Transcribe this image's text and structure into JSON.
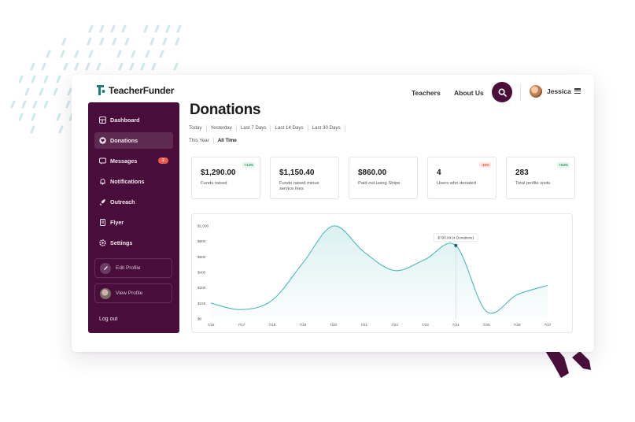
{
  "brand": {
    "name": "TeacherFunder"
  },
  "topnav": {
    "teachers": "Teachers",
    "about": "About Us"
  },
  "user": {
    "name": "Jessica"
  },
  "sidebar": {
    "items": [
      {
        "label": "Dashboard",
        "icon": "dashboard-icon"
      },
      {
        "label": "Donations",
        "icon": "heart-icon",
        "active": true
      },
      {
        "label": "Messages",
        "icon": "message-icon",
        "badge": "2"
      },
      {
        "label": "Notifications",
        "icon": "bell-icon"
      },
      {
        "label": "Outreach",
        "icon": "rocket-icon"
      },
      {
        "label": "Flyer",
        "icon": "flyer-icon"
      },
      {
        "label": "Settings",
        "icon": "gear-icon"
      }
    ],
    "edit_profile": "Edit Profile",
    "view_profile": "View Profile",
    "logout": "Log out"
  },
  "page": {
    "title": "Donations",
    "filters_row1": [
      "Today",
      "Yesterday",
      "Last 7 Days",
      "Last 14 Days",
      "Last 30 Days"
    ],
    "filters_row2": [
      "This Year",
      "All Time"
    ],
    "active_filter": "All Time"
  },
  "stats": [
    {
      "value": "$1,290.00",
      "label": "Funds raised",
      "change": "+14%",
      "trend": "up"
    },
    {
      "value": "$1,150.40",
      "label": "Funds raised minus service fees",
      "change": "",
      "trend": ""
    },
    {
      "value": "$860.00",
      "label": "Paid out using Stripe",
      "change": "",
      "trend": ""
    },
    {
      "value": "4",
      "label": "Users who donated",
      "change": "-45%",
      "trend": "down"
    },
    {
      "value": "283",
      "label": "Total profile visits",
      "change": "+64%",
      "trend": "up"
    }
  ],
  "colors": {
    "primary": "#480d3b",
    "accent": "#4cb8bb",
    "badge": "#f05b49"
  },
  "chart_data": {
    "type": "area",
    "x": [
      "7/16",
      "7/17",
      "7/18",
      "7/19",
      "7/20",
      "7/21",
      "7/22",
      "7/23",
      "7/24",
      "7/25",
      "7/26",
      "7/27"
    ],
    "y_ticks": [
      "$0",
      "$150",
      "$200",
      "$400",
      "$600",
      "$800",
      "$1,000"
    ],
    "values": [
      170,
      100,
      200,
      600,
      1000,
      720,
      520,
      640,
      790,
      80,
      260,
      360
    ],
    "ylim": [
      0,
      1000
    ],
    "tooltip": {
      "x": "7/24",
      "text": "$790.00 (4 Donations)"
    },
    "grid": false,
    "legend": "none"
  }
}
